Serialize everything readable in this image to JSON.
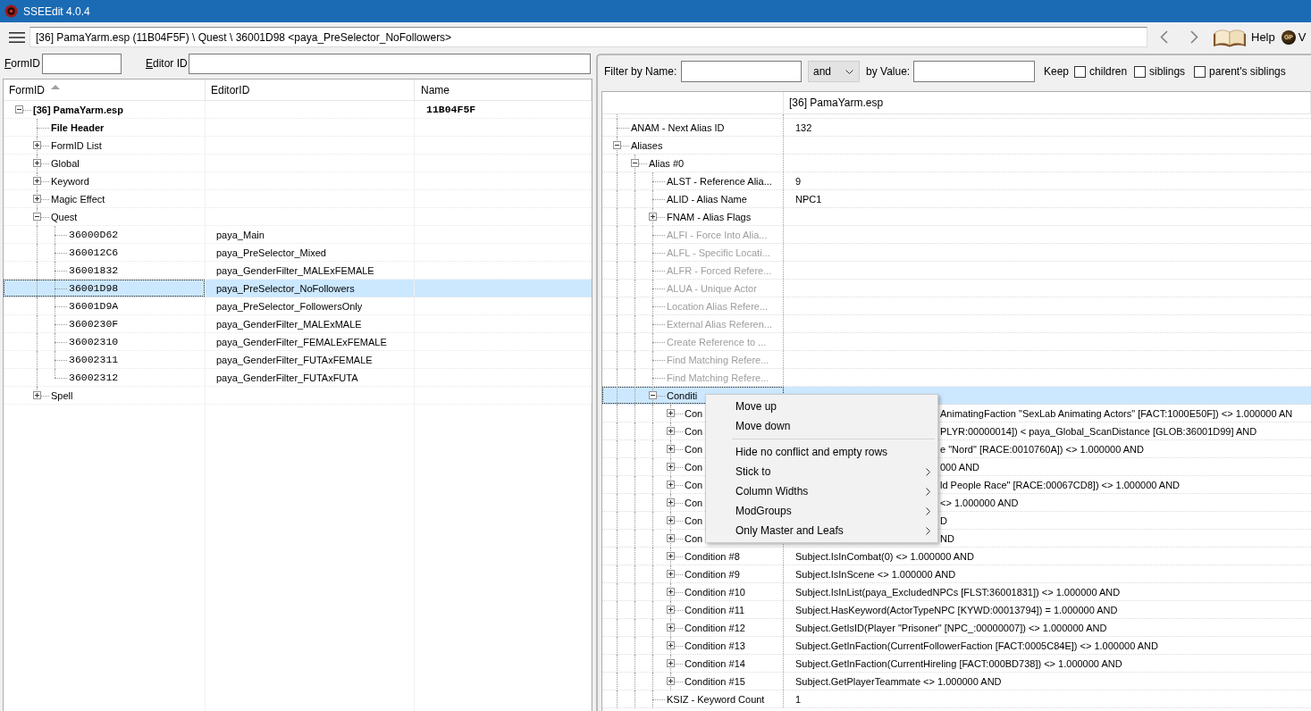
{
  "window": {
    "title": "SSEEdit 4.0.4"
  },
  "toolbar": {
    "path": "[36] PamaYarm.esp (11B04F5F) \\ Quest \\ 36001D98 <paya_PreSelector_NoFollowers>",
    "help_label": "Help",
    "extra_button": {
      "logo": "GP",
      "label": "V"
    }
  },
  "navigator_filter": [
    {
      "label": "FormID"
    },
    {
      "label": "Editor ID"
    }
  ],
  "navigator": {
    "columns": [
      {
        "label": "FormID",
        "sorted": true
      },
      {
        "label": "EditorID",
        "sorted": false
      },
      {
        "label": "Name",
        "sorted": false
      }
    ],
    "rows": [
      {
        "kind": "file",
        "label": "[36] PamaYarm.esp",
        "name": "11B04F5F",
        "expanded": true,
        "selected": false,
        "children": [
          {
            "kind": "header",
            "label": "File Header",
            "selected": false
          },
          {
            "kind": "group",
            "label": "FormID List",
            "expanded": false,
            "selected": false
          },
          {
            "kind": "group",
            "label": "Global",
            "expanded": false,
            "selected": false
          },
          {
            "kind": "group",
            "label": "Keyword",
            "expanded": false,
            "selected": false
          },
          {
            "kind": "group",
            "label": "Magic Effect",
            "expanded": false,
            "selected": false
          },
          {
            "kind": "group",
            "label": "Quest",
            "expanded": true,
            "selected": false,
            "children": [
              {
                "kind": "record",
                "label": "36000D62",
                "editor_id": "paya_Main",
                "selected": false
              },
              {
                "kind": "record",
                "label": "360012C6",
                "editor_id": "paya_PreSelector_Mixed",
                "selected": false
              },
              {
                "kind": "record",
                "label": "36001832",
                "editor_id": "paya_GenderFilter_MALExFEMALE",
                "selected": false
              },
              {
                "kind": "record",
                "label": "36001D98",
                "editor_id": "paya_PreSelector_NoFollowers",
                "selected": true
              },
              {
                "kind": "record",
                "label": "36001D9A",
                "editor_id": "paya_PreSelector_FollowersOnly",
                "selected": false
              },
              {
                "kind": "record",
                "label": "3600230F",
                "editor_id": "paya_GenderFilter_MALExMALE",
                "selected": false
              },
              {
                "kind": "record",
                "label": "36002310",
                "editor_id": "paya_GenderFilter_FEMALExFEMALE",
                "selected": false
              },
              {
                "kind": "record",
                "label": "36002311",
                "editor_id": "paya_GenderFilter_FUTAxFEMALE",
                "selected": false
              },
              {
                "kind": "record",
                "label": "36002312",
                "editor_id": "paya_GenderFilter_FUTAxFUTA",
                "selected": false
              }
            ]
          },
          {
            "kind": "group",
            "label": "Spell",
            "expanded": false,
            "selected": false
          }
        ]
      }
    ]
  },
  "record_filter": {
    "name_label": "Filter by Name:",
    "operator": "and",
    "value_label": "by Value:",
    "keep_label": "Keep",
    "keep_options": [
      {
        "label": "children",
        "checked": false
      },
      {
        "label": "siblings",
        "checked": false
      },
      {
        "label": "parent's siblings",
        "checked": false
      }
    ]
  },
  "record_view": {
    "columns": [
      {
        "label": "[36] PamaYarm.esp"
      }
    ],
    "rows": [
      {
        "label": "ANAM - Next Alias ID",
        "value": "132",
        "disabled": false,
        "selected": false
      },
      {
        "label": "Aliases",
        "expanded": true,
        "disabled": false,
        "selected": false,
        "children": [
          {
            "label": "Alias #0",
            "expanded": true,
            "disabled": false,
            "selected": false,
            "children": [
              {
                "label": "ALST - Reference Alia...",
                "value": "9",
                "disabled": false,
                "selected": false
              },
              {
                "label": "ALID - Alias Name",
                "value": "NPC1",
                "disabled": false,
                "selected": false
              },
              {
                "label": "FNAM - Alias Flags",
                "expanded": false,
                "disabled": false,
                "selected": false
              },
              {
                "label": "ALFI - Force Into Alia...",
                "disabled": true,
                "selected": false
              },
              {
                "label": "ALFL - Specific Locati...",
                "disabled": true,
                "selected": false
              },
              {
                "label": "ALFR - Forced Refere...",
                "disabled": true,
                "selected": false
              },
              {
                "label": "ALUA - Unique Actor",
                "disabled": true,
                "selected": false
              },
              {
                "label": "Location Alias Refere...",
                "disabled": true,
                "selected": false
              },
              {
                "label": "External Alias Referen...",
                "disabled": true,
                "selected": false
              },
              {
                "label": "Create Reference to ...",
                "disabled": true,
                "selected": false
              },
              {
                "label": "Find Matching Refere...",
                "disabled": true,
                "selected": false
              },
              {
                "label": "Find Matching Refere...",
                "disabled": true,
                "selected": false
              },
              {
                "label": "Conditi",
                "expanded": true,
                "disabled": false,
                "selected": true,
                "children": [
                  {
                    "label": "Con",
                    "value": "AnimatingFaction \"SexLab Animating Actors\" [FACT:1000E50F]) <> 1.000000 AN",
                    "expanded": false,
                    "disabled": false,
                    "selected": false
                  },
                  {
                    "label": "Con",
                    "value": "PLYR:00000014]) < paya_Global_ScanDistance [GLOB:36001D99] AND",
                    "expanded": false,
                    "disabled": false,
                    "selected": false
                  },
                  {
                    "label": "Con",
                    "value": "e \"Nord\" [RACE:0010760A]) <> 1.000000 AND",
                    "expanded": false,
                    "disabled": false,
                    "selected": false
                  },
                  {
                    "label": "Con",
                    "value": "000 AND",
                    "expanded": false,
                    "disabled": false,
                    "selected": false
                  },
                  {
                    "label": "Con",
                    "value": "ld People Race\" [RACE:00067CD8]) <> 1.000000 AND",
                    "expanded": false,
                    "disabled": false,
                    "selected": false
                  },
                  {
                    "label": "Con",
                    "value": "<> 1.000000 AND",
                    "expanded": false,
                    "disabled": false,
                    "selected": false
                  },
                  {
                    "label": "Con",
                    "value": "D",
                    "expanded": false,
                    "disabled": false,
                    "selected": false
                  },
                  {
                    "label": "Con",
                    "value": "ND",
                    "expanded": false,
                    "disabled": false,
                    "selected": false
                  },
                  {
                    "label": "Condition #8",
                    "value": "Subject.IsInCombat(0) <> 1.000000 AND",
                    "expanded": false,
                    "disabled": false,
                    "selected": false
                  },
                  {
                    "label": "Condition #9",
                    "value": "Subject.IsInScene <> 1.000000 AND",
                    "expanded": false,
                    "disabled": false,
                    "selected": false
                  },
                  {
                    "label": "Condition #10",
                    "value": "Subject.IsInList(paya_ExcludedNPCs [FLST:36001831]) <> 1.000000 AND",
                    "expanded": false,
                    "disabled": false,
                    "selected": false
                  },
                  {
                    "label": "Condition #11",
                    "value": "Subject.HasKeyword(ActorTypeNPC [KYWD:00013794]) = 1.000000 AND",
                    "expanded": false,
                    "disabled": false,
                    "selected": false
                  },
                  {
                    "label": "Condition #12",
                    "value": "Subject.GetIsID(Player \"Prisoner\" [NPC_:00000007]) <> 1.000000 AND",
                    "expanded": false,
                    "disabled": false,
                    "selected": false
                  },
                  {
                    "label": "Condition #13",
                    "value": "Subject.GetInFaction(CurrentFollowerFaction [FACT:0005C84E]) <> 1.000000 AND",
                    "expanded": false,
                    "disabled": false,
                    "selected": false
                  },
                  {
                    "label": "Condition #14",
                    "value": "Subject.GetInFaction(CurrentHireling [FACT:000BD738]) <> 1.000000 AND",
                    "expanded": false,
                    "disabled": false,
                    "selected": false
                  },
                  {
                    "label": "Condition #15",
                    "value": "Subject.GetPlayerTeammate <> 1.000000 AND",
                    "expanded": false,
                    "disabled": false,
                    "selected": false
                  }
                ]
              },
              {
                "label": "KSIZ - Keyword Count",
                "value": "1",
                "disabled": false,
                "selected": false
              }
            ]
          }
        ]
      }
    ]
  },
  "context_menu": {
    "items": [
      {
        "kind": "item",
        "label": "Move up",
        "submenu": false
      },
      {
        "kind": "item",
        "label": "Move down",
        "submenu": false
      },
      {
        "kind": "separator"
      },
      {
        "kind": "item",
        "label": "Hide no conflict and empty rows",
        "submenu": false
      },
      {
        "kind": "item",
        "label": "Stick to",
        "submenu": true
      },
      {
        "kind": "item",
        "label": "Column Widths",
        "submenu": true
      },
      {
        "kind": "item",
        "label": "ModGroups",
        "submenu": true
      },
      {
        "kind": "item",
        "label": "Only Master and Leafs",
        "submenu": true
      }
    ]
  }
}
